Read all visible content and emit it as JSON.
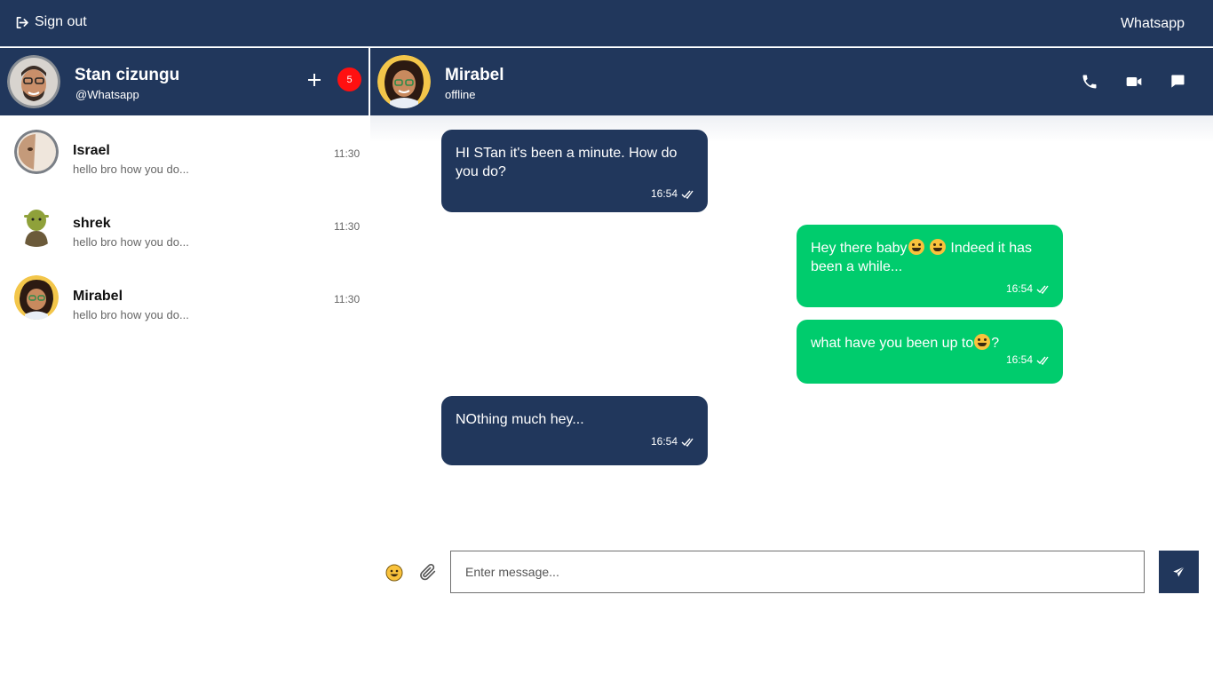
{
  "topbar": {
    "signout_label": "Sign out",
    "brand": "Whatsapp"
  },
  "user": {
    "name": "Stan cizungu",
    "handle": "@Whatsapp",
    "badge_count": "5"
  },
  "chat_header": {
    "name": "Mirabel",
    "status": "offline"
  },
  "contacts": [
    {
      "name": "Israel",
      "preview": "hello bro how you do...",
      "time": "11:30"
    },
    {
      "name": "shrek",
      "preview": "hello bro how you do...",
      "time": "11:30"
    },
    {
      "name": "Mirabel",
      "preview": "hello bro how you do...",
      "time": "11:30"
    }
  ],
  "messages": [
    {
      "direction": "in",
      "text": "HI STan it's been a minute. How do you do?",
      "time": "16:54"
    },
    {
      "direction": "out",
      "text_a": "Hey there baby",
      "text_b": " Indeed it has been a while...",
      "time": "16:54"
    },
    {
      "direction": "out",
      "text_a": "what have you been up to",
      "text_b": "?",
      "time": "16:54"
    },
    {
      "direction": "in",
      "text": "NOthing much hey...",
      "time": "16:54"
    }
  ],
  "composer": {
    "placeholder": "Enter message..."
  },
  "colors": {
    "navy": "#21375c",
    "green": "#00cc6d",
    "badge": "#ff1010"
  }
}
